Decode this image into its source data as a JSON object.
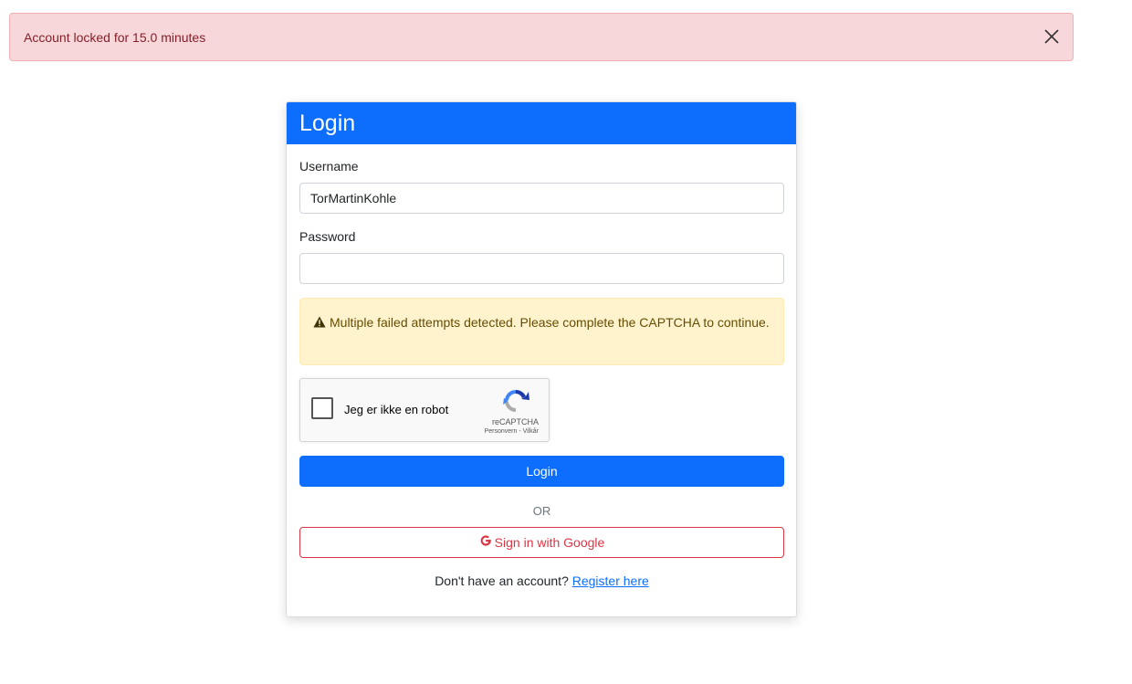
{
  "alert": {
    "message": "Account locked for 15.0 minutes",
    "close_icon": "close-icon",
    "colors": {
      "background": "#f8d7da",
      "text": "#842029"
    }
  },
  "login_card": {
    "title": "Login",
    "username_label": "Username",
    "username_value": "TorMartinKohle",
    "password_label": "Password",
    "password_value": "",
    "warning": {
      "icon": "warning-icon",
      "text": "Multiple failed attempts detected. Please complete the CAPTCHA to continue."
    },
    "captcha": {
      "label": "Jeg er ikke en robot",
      "brand": "reCAPTCHA",
      "links": "Personvern - Vilkår",
      "checked": false
    },
    "login_button": "Login",
    "or_text": "OR",
    "google_button": "Sign in with Google",
    "google_icon": "google-icon",
    "register_prompt": "Don't have an account?",
    "register_link": "Register here"
  },
  "colors": {
    "primary": "#0d6efd",
    "danger": "#dc3545",
    "warning_bg": "#fff3cd"
  }
}
